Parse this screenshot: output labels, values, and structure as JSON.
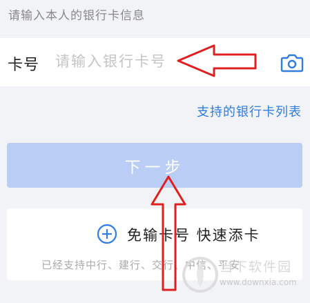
{
  "header": {
    "hint": "请输入本人的银行卡信息"
  },
  "card_field": {
    "label": "卡号",
    "value": "",
    "placeholder": "请输入银行卡号",
    "scan_icon": "camera-icon"
  },
  "supported_link": "支持的银行卡列表",
  "next_button": {
    "label": "下一步"
  },
  "quick_add": {
    "icon": "plus-circle-icon",
    "title": "免输卡号  快速添卡",
    "subtitle": "已经支持中行、建行、交行、中信、平安"
  },
  "watermark": {
    "name": "当下软件园",
    "url": "www.downxia.com"
  },
  "colors": {
    "accent": "#2f7de1",
    "button": "#b9cdf5",
    "background": "#f2f3f7",
    "annotation_arrow": "#e02020"
  }
}
